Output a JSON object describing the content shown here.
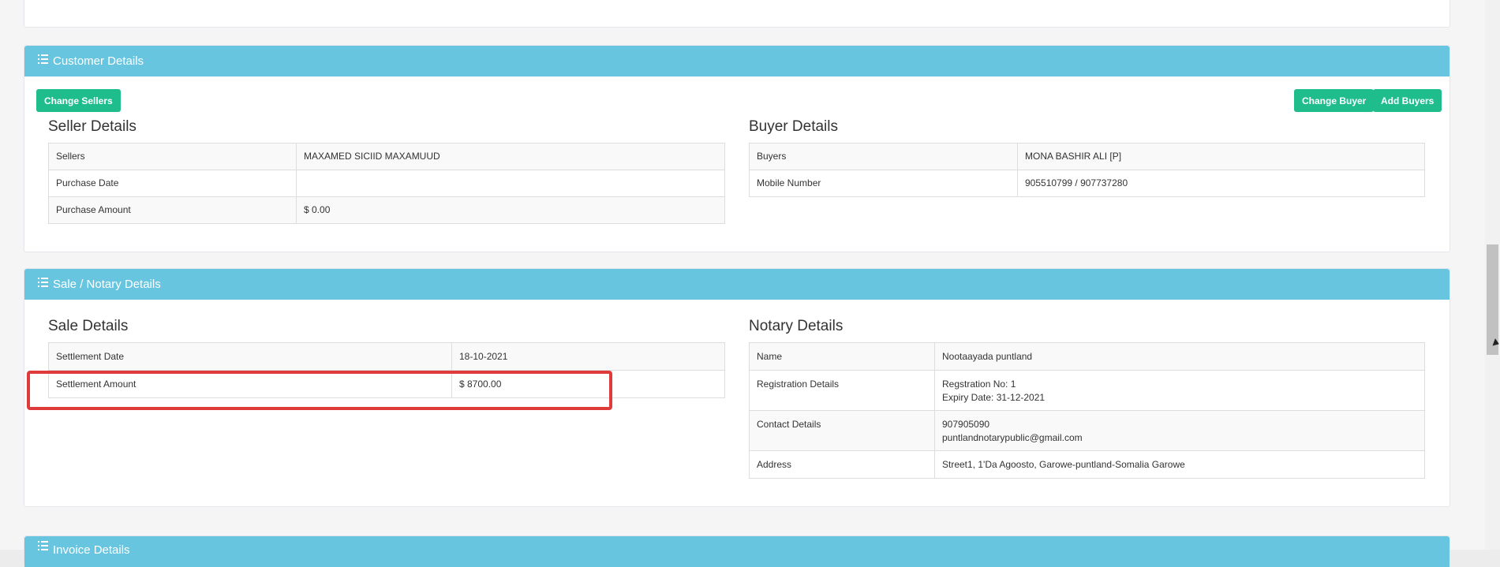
{
  "customer": {
    "heading": "Customer Details",
    "change_sellers": "Change Sellers",
    "change_buyer": "Change Buyer",
    "add_buyers": "Add Buyers",
    "seller_title": "Seller Details",
    "sellers": [
      {
        "label": "Sellers",
        "value": "MAXAMED SICIID MAXAMUUD"
      },
      {
        "label": "Purchase Date",
        "value": ""
      },
      {
        "label": "Purchase Amount",
        "value": "$ 0.00"
      }
    ],
    "buyer_title": "Buyer Details",
    "buyers": [
      {
        "label": "Buyers",
        "value": "MONA BASHIR ALI [P]"
      },
      {
        "label": "Mobile Number",
        "value": "905510799 / 907737280"
      }
    ]
  },
  "sale": {
    "heading": "Sale / Notary Details",
    "sale_title": "Sale Details",
    "sale_rows": [
      {
        "label": "Settlement Date",
        "value": "18-10-2021"
      },
      {
        "label": "Settlement Amount",
        "value": "$ 8700.00"
      }
    ],
    "notary_title": "Notary Details",
    "notary_rows": [
      {
        "label": "Name",
        "value": "Nootaayada puntland",
        "value2": ""
      },
      {
        "label": "Registration Details",
        "value": "Regstration No: 1",
        "value2": "Expiry Date: 31-12-2021"
      },
      {
        "label": "Contact Details",
        "value": "907905090",
        "value2": "puntlandnotarypublic@gmail.com"
      },
      {
        "label": "Address",
        "value": "Street1, 1'Da Agoosto, Garowe-puntland-Somalia Garowe",
        "value2": ""
      }
    ]
  },
  "next_section": {
    "heading": "Invoice Details"
  }
}
